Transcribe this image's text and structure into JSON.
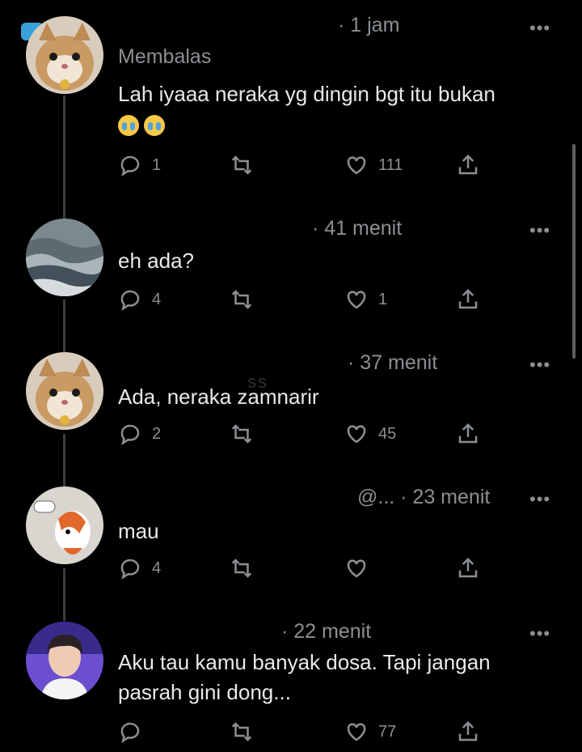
{
  "tweets": [
    {
      "time": "· 1 jam",
      "reply_label": "Membalas",
      "text": "Lah iyaaa neraka yg dingin bgt itu bukan",
      "replies": "1",
      "retweets": "",
      "likes": "111",
      "avatar_icon": "cat-avatar-icon"
    },
    {
      "time": "· 41 menit",
      "text": "eh ada?",
      "replies": "4",
      "retweets": "",
      "likes": "1",
      "avatar_icon": "ocean-avatar-icon"
    },
    {
      "time": "· 37 menit",
      "text": "Ada, neraka zamnarir",
      "replies": "2",
      "retweets": "",
      "likes": "45",
      "avatar_icon": "cat-avatar-icon"
    },
    {
      "time": "@... · 23 menit",
      "text": "mau",
      "replies": "4",
      "retweets": "",
      "likes": "",
      "avatar_icon": "fish-avatar-icon"
    },
    {
      "time": "· 22 menit",
      "text_line1": "Aku tau kamu banyak dosa. Tapi jangan",
      "text_line2": "pasrah gini dong...",
      "replies": "",
      "retweets": "",
      "likes": "77",
      "avatar_icon": "person-avatar-icon"
    }
  ],
  "ui": {
    "more_label": "•••",
    "ghost_text": "ss"
  },
  "colors": {
    "background": "#000000",
    "text": "#e7e9ea",
    "muted": "#8b8f93",
    "thread_line": "#3a3d41"
  }
}
